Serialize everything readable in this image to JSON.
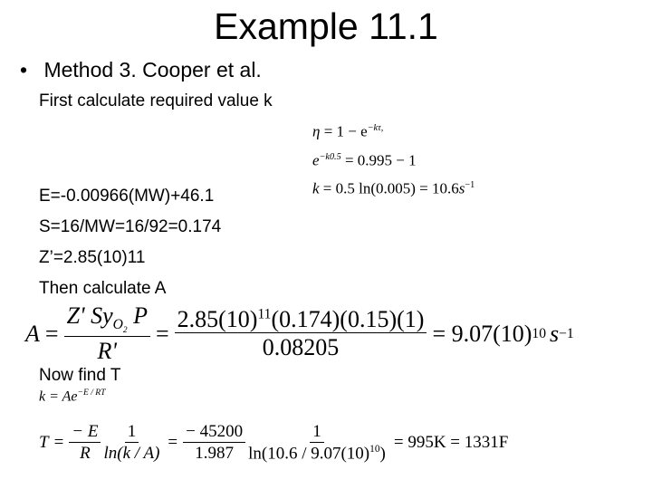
{
  "title": "Example 11.1",
  "bullet": "Method 3. Cooper et al.",
  "intro": "First calculate required value k",
  "k_equations": {
    "eq1": {
      "lhs": "η",
      "rhs": "= 1 − e",
      "sup": "−kτ,"
    },
    "eq2": {
      "base": "e",
      "sup": "−k0.5",
      "rhs": "= 0.995 − 1"
    },
    "eq3": {
      "lhs": "k",
      "rhs": "= 0.5 ln(0.005) = 10.6",
      "unit": "s",
      "unit_sup": "−1"
    }
  },
  "lines": [
    "E=-0.00966(MW)+46.1",
    "S=16/MW=16/92=0.174",
    "Z’=2.85(10)11",
    "Then calculate A"
  ],
  "A_equation": {
    "lhs": "A",
    "frac1_num": "Z' Sy",
    "frac1_sub": "O",
    "frac1_sub2": "2",
    "frac1_num_tail": " P",
    "frac1_den": "R'",
    "frac2_num_a": "2.85(10)",
    "frac2_num_sup": "11",
    "frac2_num_b": "(0.174)(0.15)(1)",
    "frac2_den": "0.08205",
    "result_a": "= 9.07(10)",
    "result_sup": "10",
    "result_unit": "s",
    "result_unit_sup": "−1"
  },
  "now_find": "Now find T",
  "k_formula": {
    "text": "k = Ae",
    "sup": "−E / RT"
  },
  "T_equation": {
    "lhs": "T",
    "f1_num": "− E",
    "f1_den": "R",
    "f2_num": "1",
    "f2_den": "ln(k / A)",
    "f3_num": "− 45200",
    "f3_den": "1.987",
    "f4_num": "1",
    "f4_den_a": "ln(10.6 / 9.07(10)",
    "f4_den_sup": "10",
    "f4_den_b": ")",
    "result": "= 995K = 1331F"
  }
}
